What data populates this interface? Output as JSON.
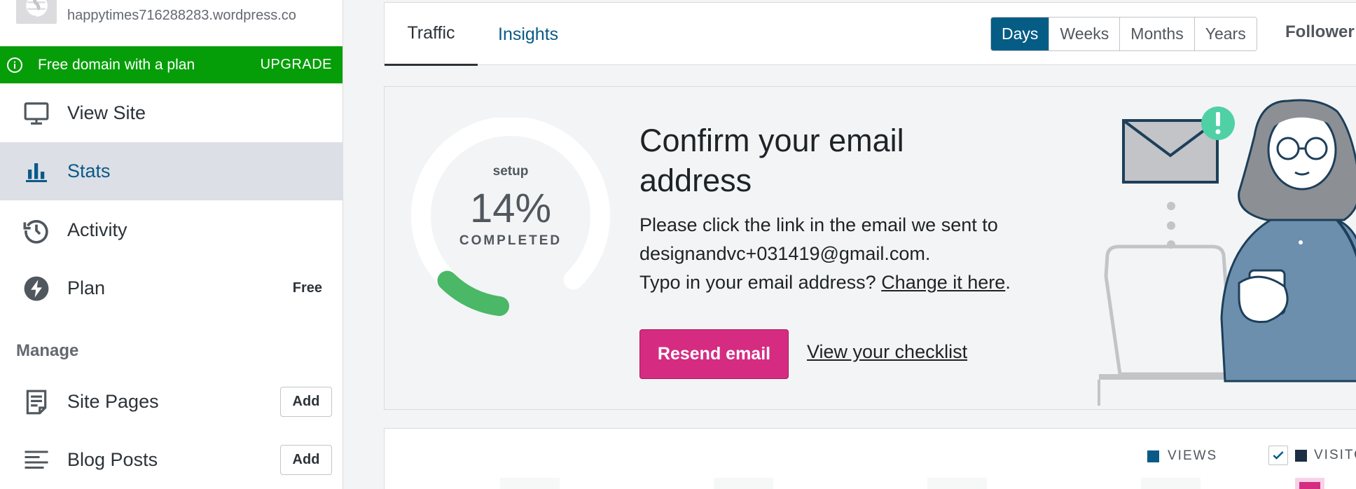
{
  "site": {
    "url": "happytimes716288283.wordpress.co"
  },
  "promo": {
    "text": "Free domain with a plan",
    "action": "UPGRADE"
  },
  "sidebar": {
    "items": [
      {
        "label": "View Site",
        "icon": "monitor-icon"
      },
      {
        "label": "Stats",
        "icon": "bar-chart-icon"
      },
      {
        "label": "Activity",
        "icon": "history-icon"
      },
      {
        "label": "Plan",
        "icon": "bolt-icon",
        "badge": "Free"
      }
    ],
    "manage_header": "Manage",
    "manage_items": [
      {
        "label": "Site Pages",
        "icon": "page-icon",
        "action": "Add"
      },
      {
        "label": "Blog Posts",
        "icon": "posts-icon",
        "action": "Add"
      }
    ]
  },
  "tabs": {
    "items": [
      "Traffic",
      "Insights"
    ],
    "active": "Traffic",
    "periods": [
      "Days",
      "Weeks",
      "Months",
      "Years"
    ],
    "selected_period": "Days",
    "followers": "Follower"
  },
  "confirm": {
    "progress": {
      "setup_label": "setup",
      "percent_text": "14%",
      "percent_value": 14,
      "completed_label": "COMPLETED",
      "color": "#4ab866"
    },
    "title": "Confirm your email address",
    "line1": "Please click the link in the email we sent to",
    "email": "designandvc+031419@gmail.com.",
    "line3_prefix": "Typo in your email address?",
    "change_link": "Change it here",
    "line3_suffix": ".",
    "resend_button": "Resend email",
    "checklist_link": "View your checklist",
    "button_color": "#d52c82"
  },
  "chart": {
    "legend_views": "VIEWS",
    "legend_visitors": "VISITORS"
  }
}
